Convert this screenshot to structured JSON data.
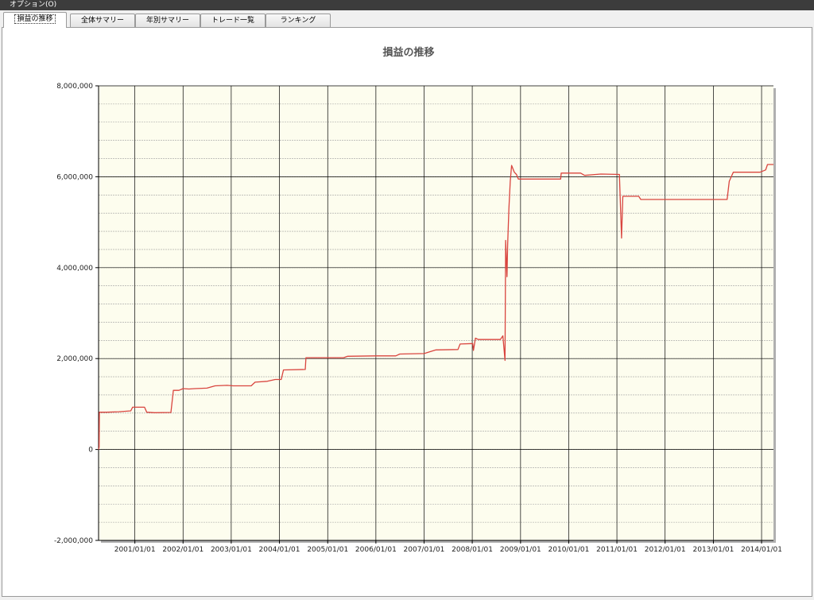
{
  "window": {
    "menu_label": "オプション(O)"
  },
  "tabs": [
    {
      "label": "損益の推移",
      "active": true
    },
    {
      "label": "全体サマリー",
      "active": false
    },
    {
      "label": "年別サマリー",
      "active": false
    },
    {
      "label": "トレード一覧",
      "active": false
    },
    {
      "label": "ランキング",
      "active": false
    }
  ],
  "colors": {
    "plot_background": "#fdfdee",
    "line": "#d9453f",
    "gridline_major": "#000000",
    "gridline_minor": "#a0a0a0"
  },
  "chart_data": {
    "type": "line",
    "title": "損益の推移",
    "xlabel": "",
    "ylabel": "",
    "ylim": [
      -2000000,
      8000000
    ],
    "xlim": [
      "2000-04-01",
      "2014-04-01"
    ],
    "y_ticks": [
      8000000,
      6000000,
      4000000,
      2000000,
      0,
      -2000000
    ],
    "y_tick_labels": [
      "8,000,000",
      "6,000,000",
      "4,000,000",
      "2,000,000",
      "0",
      "-2,000,000"
    ],
    "x_ticks": [
      "2001-01-01",
      "2002-01-01",
      "2003-01-01",
      "2004-01-01",
      "2005-01-01",
      "2006-01-01",
      "2007-01-01",
      "2008-01-01",
      "2009-01-01",
      "2010-01-01",
      "2011-01-01",
      "2012-01-01",
      "2013-01-01",
      "2014-01-01"
    ],
    "x_tick_labels": [
      "2001/01/01",
      "2002/01/01",
      "2003/01/01",
      "2004/01/01",
      "2005/01/01",
      "2006/01/01",
      "2007/01/01",
      "2008/01/01",
      "2009/01/01",
      "2010/01/01",
      "2011/01/01",
      "2012/01/01",
      "2013/01/01",
      "2014/01/01"
    ],
    "y_minor_step": 400000,
    "grid": true,
    "series": [
      {
        "points": [
          [
            "2000-04-01",
            0
          ],
          [
            "2000-04-05",
            50000
          ],
          [
            "2000-04-07",
            820000
          ],
          [
            "2000-06-01",
            820000
          ],
          [
            "2000-09-01",
            830000
          ],
          [
            "2000-12-01",
            850000
          ],
          [
            "2000-12-15",
            930000
          ],
          [
            "2001-03-15",
            930000
          ],
          [
            "2001-04-01",
            820000
          ],
          [
            "2001-06-01",
            810000
          ],
          [
            "2001-10-01",
            815000
          ],
          [
            "2001-10-20",
            1300000
          ],
          [
            "2001-12-01",
            1300000
          ],
          [
            "2002-01-01",
            1340000
          ],
          [
            "2002-02-15",
            1330000
          ],
          [
            "2002-04-01",
            1340000
          ],
          [
            "2002-07-01",
            1350000
          ],
          [
            "2002-09-01",
            1400000
          ],
          [
            "2002-12-01",
            1410000
          ],
          [
            "2003-01-15",
            1400000
          ],
          [
            "2003-06-01",
            1400000
          ],
          [
            "2003-07-01",
            1480000
          ],
          [
            "2003-10-01",
            1500000
          ],
          [
            "2003-12-01",
            1540000
          ],
          [
            "2004-01-15",
            1540000
          ],
          [
            "2004-02-01",
            1750000
          ],
          [
            "2004-07-15",
            1760000
          ],
          [
            "2004-07-20",
            2020000
          ],
          [
            "2005-05-01",
            2020000
          ],
          [
            "2005-06-01",
            2050000
          ],
          [
            "2006-01-01",
            2060000
          ],
          [
            "2006-06-01",
            2060000
          ],
          [
            "2006-07-01",
            2100000
          ],
          [
            "2007-01-01",
            2110000
          ],
          [
            "2007-04-01",
            2190000
          ],
          [
            "2007-09-15",
            2200000
          ],
          [
            "2007-10-01",
            2320000
          ],
          [
            "2008-01-05",
            2330000
          ],
          [
            "2008-01-10",
            2180000
          ],
          [
            "2008-01-25",
            2450000
          ],
          [
            "2008-02-15",
            2420000
          ],
          [
            "2008-08-01",
            2420000
          ],
          [
            "2008-08-20",
            2500000
          ],
          [
            "2008-09-05",
            1960000
          ],
          [
            "2008-09-10",
            4600000
          ],
          [
            "2008-09-20",
            3800000
          ],
          [
            "2008-09-25",
            4500000
          ],
          [
            "2008-10-05",
            5300000
          ],
          [
            "2008-10-15",
            5900000
          ],
          [
            "2008-10-25",
            6250000
          ],
          [
            "2008-11-15",
            6100000
          ],
          [
            "2008-12-01",
            6050000
          ],
          [
            "2008-12-15",
            5950000
          ],
          [
            "2009-05-01",
            5950000
          ],
          [
            "2009-11-01",
            5950000
          ],
          [
            "2009-11-05",
            6080000
          ],
          [
            "2010-04-01",
            6080000
          ],
          [
            "2010-05-01",
            6030000
          ],
          [
            "2010-09-01",
            6060000
          ],
          [
            "2011-01-20",
            6050000
          ],
          [
            "2011-02-05",
            4650000
          ],
          [
            "2011-02-15",
            5570000
          ],
          [
            "2011-06-15",
            5570000
          ],
          [
            "2011-07-01",
            5500000
          ],
          [
            "2012-08-01",
            5500000
          ],
          [
            "2013-04-15",
            5500000
          ],
          [
            "2013-05-01",
            5900000
          ],
          [
            "2013-06-01",
            6100000
          ],
          [
            "2013-12-20",
            6100000
          ],
          [
            "2014-02-01",
            6150000
          ],
          [
            "2014-02-15",
            6270000
          ],
          [
            "2014-04-01",
            6270000
          ]
        ]
      }
    ]
  }
}
